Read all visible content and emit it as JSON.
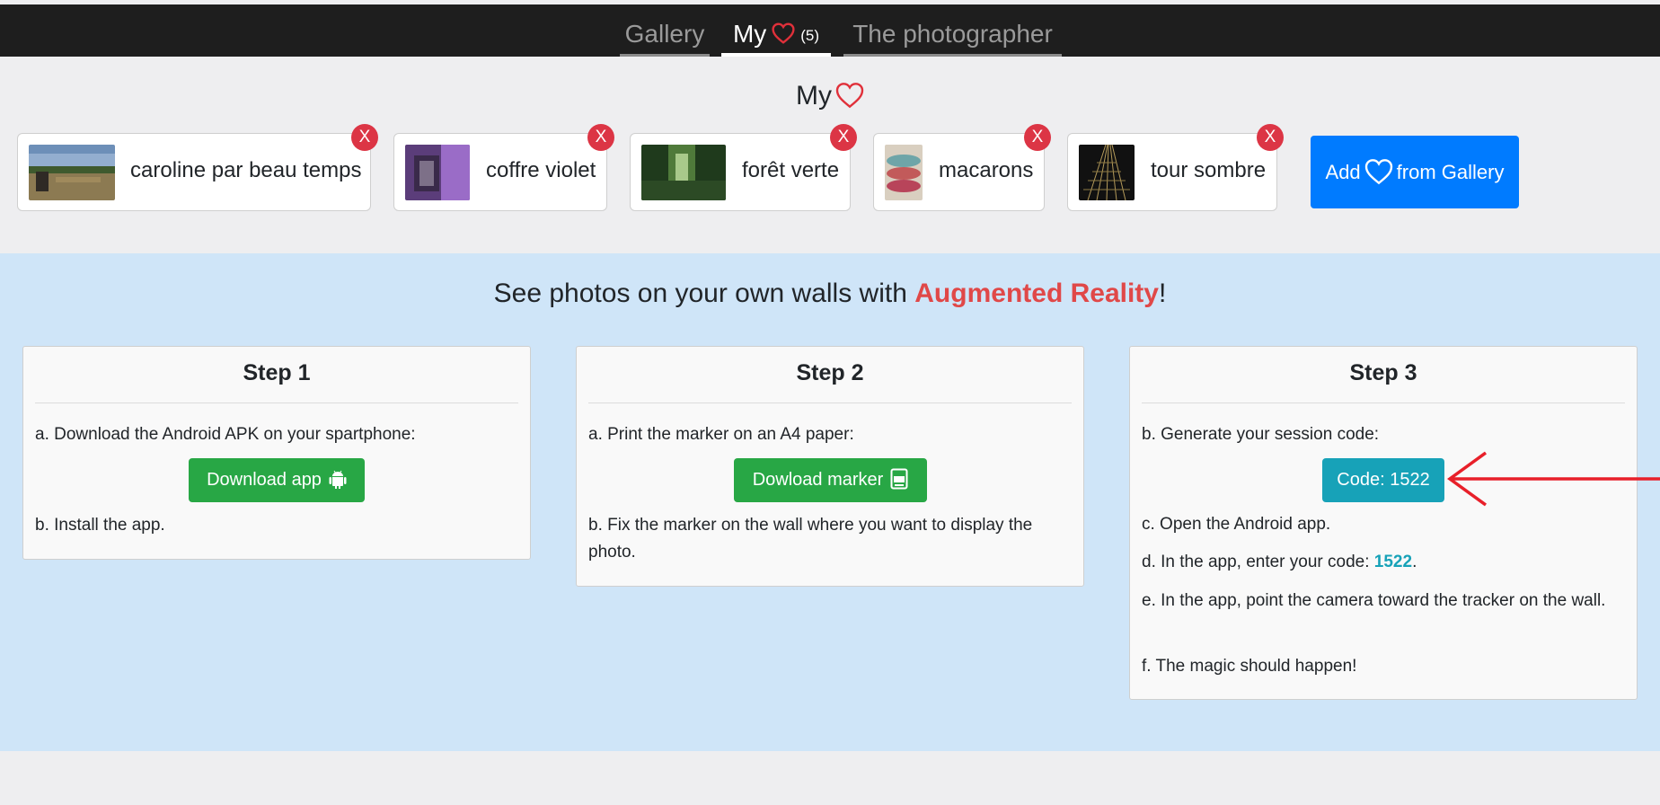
{
  "nav": {
    "tabs": [
      {
        "label": "Gallery"
      },
      {
        "label": "My",
        "count": "(5)"
      },
      {
        "label": "The photographer"
      }
    ]
  },
  "favorites": {
    "title": "My",
    "items": [
      {
        "name": "caroline par beau temps",
        "remove": "X"
      },
      {
        "name": "coffre violet",
        "remove": "X"
      },
      {
        "name": "forêt verte",
        "remove": "X"
      },
      {
        "name": "macarons",
        "remove": "X"
      },
      {
        "name": "tour sombre",
        "remove": "X"
      }
    ],
    "add_before": "Add",
    "add_after": "from Gallery"
  },
  "ar": {
    "heading_before": "See photos on your own walls with",
    "heading_highlight": "Augmented Reality",
    "heading_after": "!",
    "steps": [
      {
        "title": "Step 1",
        "a": "a. Download the Android APK on your spartphone:",
        "button": "Download app",
        "b": "b. Install the app."
      },
      {
        "title": "Step 2",
        "a": "a. Print the marker on an A4 paper:",
        "button": "Dowload marker",
        "b": "b. Fix the marker on the wall where you want to display the photo."
      },
      {
        "title": "Step 3",
        "b": "b. Generate your session code:",
        "button": "Code: 1522",
        "c": "c. Open the Android app.",
        "d_before": "d. In the app, enter your code:",
        "d_code": "1522",
        "d_after": ".",
        "e": "e. In the app, point the camera toward the tracker on the wall.",
        "f": "f. The magic should happen!"
      }
    ]
  },
  "colors": {
    "accent_red": "#e04848",
    "primary": "#007bff",
    "success": "#28a745",
    "info": "#17a2b8",
    "danger": "#dc3545"
  },
  "icons": [
    "heart-icon",
    "android-icon",
    "pdf-icon",
    "red-arrow-icon"
  ]
}
